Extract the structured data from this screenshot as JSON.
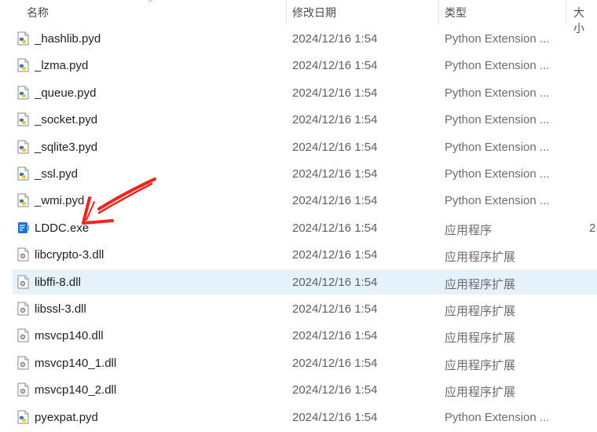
{
  "columns": {
    "name": "名称",
    "modified": "修改日期",
    "type": "类型",
    "size": "大小"
  },
  "files": [
    {
      "name": "_hashlib.pyd",
      "date": "2024/12/16 1:54",
      "type": "Python Extension ...",
      "size": "",
      "icon": "python-file-icon"
    },
    {
      "name": "_lzma.pyd",
      "date": "2024/12/16 1:54",
      "type": "Python Extension ...",
      "size": "",
      "icon": "python-file-icon"
    },
    {
      "name": "_queue.pyd",
      "date": "2024/12/16 1:54",
      "type": "Python Extension ...",
      "size": "",
      "icon": "python-file-icon"
    },
    {
      "name": "_socket.pyd",
      "date": "2024/12/16 1:54",
      "type": "Python Extension ...",
      "size": "",
      "icon": "python-file-icon"
    },
    {
      "name": "_sqlite3.pyd",
      "date": "2024/12/16 1:54",
      "type": "Python Extension ...",
      "size": "",
      "icon": "python-file-icon"
    },
    {
      "name": "_ssl.pyd",
      "date": "2024/12/16 1:54",
      "type": "Python Extension ...",
      "size": "",
      "icon": "python-file-icon"
    },
    {
      "name": "_wmi.pyd",
      "date": "2024/12/16 1:54",
      "type": "Python Extension ...",
      "size": "",
      "icon": "python-file-icon"
    },
    {
      "name": "LDDC.exe",
      "date": "2024/12/16 1:54",
      "type": "应用程序",
      "size": "2",
      "icon": "exe-app-icon"
    },
    {
      "name": "libcrypto-3.dll",
      "date": "2024/12/16 1:54",
      "type": "应用程序扩展",
      "size": "",
      "icon": "dll-file-icon"
    },
    {
      "name": "libffi-8.dll",
      "date": "2024/12/16 1:54",
      "type": "应用程序扩展",
      "size": "",
      "icon": "dll-file-icon",
      "selected": true
    },
    {
      "name": "libssl-3.dll",
      "date": "2024/12/16 1:54",
      "type": "应用程序扩展",
      "size": "",
      "icon": "dll-file-icon"
    },
    {
      "name": "msvcp140.dll",
      "date": "2024/12/16 1:54",
      "type": "应用程序扩展",
      "size": "",
      "icon": "dll-file-icon"
    },
    {
      "name": "msvcp140_1.dll",
      "date": "2024/12/16 1:54",
      "type": "应用程序扩展",
      "size": "",
      "icon": "dll-file-icon"
    },
    {
      "name": "msvcp140_2.dll",
      "date": "2024/12/16 1:54",
      "type": "应用程序扩展",
      "size": "",
      "icon": "dll-file-icon"
    },
    {
      "name": "pyexpat.pyd",
      "date": "2024/12/16 1:54",
      "type": "Python Extension ...",
      "size": "",
      "icon": "python-file-icon"
    }
  ],
  "colors": {
    "selection": "#e5f1fb",
    "annotation_arrow": "#e8271f"
  }
}
